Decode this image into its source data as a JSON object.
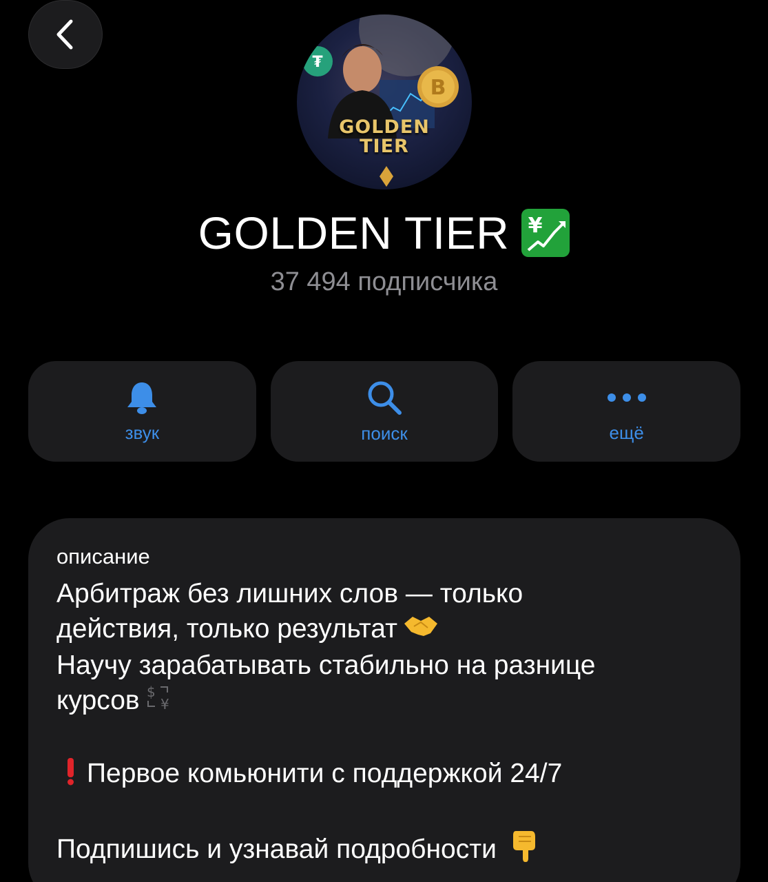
{
  "header": {
    "back_icon": "chevron-left-icon"
  },
  "channel": {
    "avatar_text_line1": "GOLDEN",
    "avatar_text_line2": "TIER",
    "title": "GOLDEN TIER",
    "title_badge_icon": "chart-increasing-with-yen-icon",
    "subscribers": "37 494 подписчика"
  },
  "actions": [
    {
      "icon": "bell-icon",
      "label": "звук"
    },
    {
      "icon": "search-icon",
      "label": "поиск"
    },
    {
      "icon": "more-dots-icon",
      "label": "ещё"
    }
  ],
  "description": {
    "label": "описание",
    "line1": "Арбитраж без лишних слов — только",
    "line2": "действия, только результат",
    "line2_emoji": "handshake-icon",
    "line3": "Научу зарабатывать стабильно на разнице",
    "line4": "курсов",
    "line4_emoji": "currency-exchange-icon",
    "line5": "Первое комьюнити с поддержкой 24/7",
    "line5_emoji": "exclamation-mark-icon",
    "line6": "Подпишись и узнавай подробности",
    "line6_emoji": "backhand-index-pointing-down-icon"
  },
  "colors": {
    "accent": "#3d8ee8",
    "card": "#1c1c1e",
    "muted": "#8e8e93",
    "badge_green": "#22a23a"
  }
}
